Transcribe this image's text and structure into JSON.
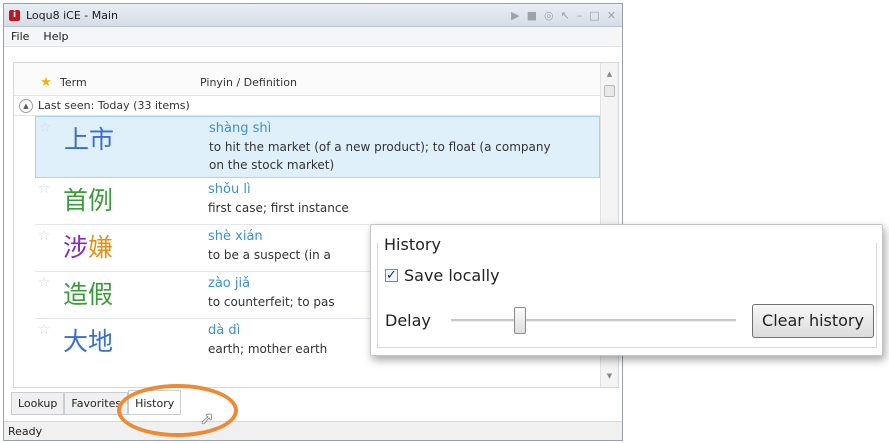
{
  "window": {
    "title": "Loqu8 iCE - Main",
    "icon_glyph": "i",
    "controls": [
      "▶",
      "■",
      "◎",
      "↖",
      "–",
      "□",
      "✕"
    ]
  },
  "menu": [
    "File",
    "Help"
  ],
  "columns": {
    "term": "Term",
    "pinyin": "Pinyin / Definition"
  },
  "group": {
    "label": "Last seen: Today (33 items)"
  },
  "entries": [
    {
      "term": "上市",
      "pinyin": "shàng shì",
      "definition": "to hit the market (of a new product); to float (a company on the stock market)",
      "color": "#3a6fd0"
    },
    {
      "term": "首例",
      "pinyin": "shǒu lì",
      "definition": "first case; first instance",
      "color": "#3d9a3d"
    },
    {
      "term": "涉嫌",
      "pinyin": "shè xián",
      "definition": "to be a suspect (in a",
      "chars": [
        {
          "c": "涉",
          "color": "#8a2bb8"
        },
        {
          "c": "嫌",
          "color": "#e69215"
        }
      ]
    },
    {
      "term": "造假",
      "pinyin": "zào jiǎ",
      "definition": "to counterfeit; to pas",
      "color": "#3d9a3d"
    },
    {
      "term": "大地",
      "pinyin": "dà dì",
      "definition": "earth; mother earth",
      "color": "#3a6fd0"
    }
  ],
  "tabs": [
    "Lookup",
    "Favorites",
    "History"
  ],
  "active_tab": "History",
  "status": "Ready",
  "history_panel": {
    "title": "History",
    "save_locally": "Save locally",
    "save_locally_checked": true,
    "delay_label": "Delay",
    "delay_level": 0.25,
    "clear_button": "Clear history"
  }
}
